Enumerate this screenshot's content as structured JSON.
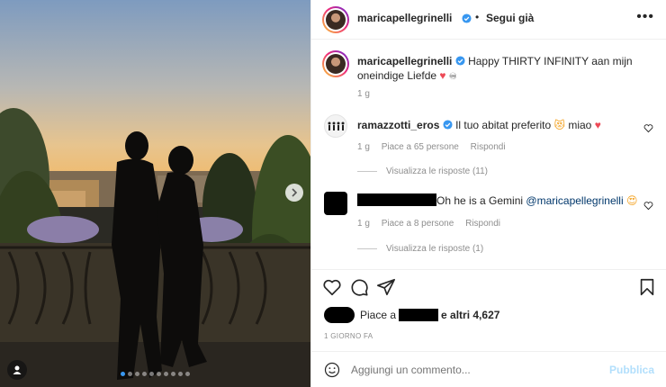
{
  "header": {
    "username": "maricapellegrinelli",
    "separator": "•",
    "follow_label": "Segui già",
    "more_icon": "more-horizontal-icon"
  },
  "caption": {
    "username": "maricapellegrinelli",
    "text": "Happy THIRTY INFINITY aan mijn oneindige Liefde",
    "time": "1 g"
  },
  "comments": [
    {
      "username": "ramazzotti_eros",
      "text_1": "Il tuo abitat preferito",
      "text_2": "miao",
      "time": "1 g",
      "likes": "Piace a 65 persone",
      "reply_label": "Rispondi",
      "view_replies": "Visualizza le risposte (11)"
    },
    {
      "text": "Oh he is a Gemini",
      "mention": "@maricapellegrinelli",
      "time": "1 g",
      "likes": "Piace a 8 persone",
      "reply_label": "Rispondi",
      "view_replies": "Visualizza le risposte (1)"
    }
  ],
  "likes_summary": {
    "prefix": "Piace a",
    "suffix": "e altri 4,627"
  },
  "post_time": "1 GIORNO FA",
  "add_comment": {
    "placeholder": "Aggiungi un commento...",
    "publish_label": "Pubblica"
  },
  "carousel": {
    "total": 10,
    "active": 1
  },
  "colors": {
    "accent": "#3897f0",
    "heart": "#ed4956",
    "publish_disabled": "#b2dffc",
    "verified": "#3897f0"
  }
}
